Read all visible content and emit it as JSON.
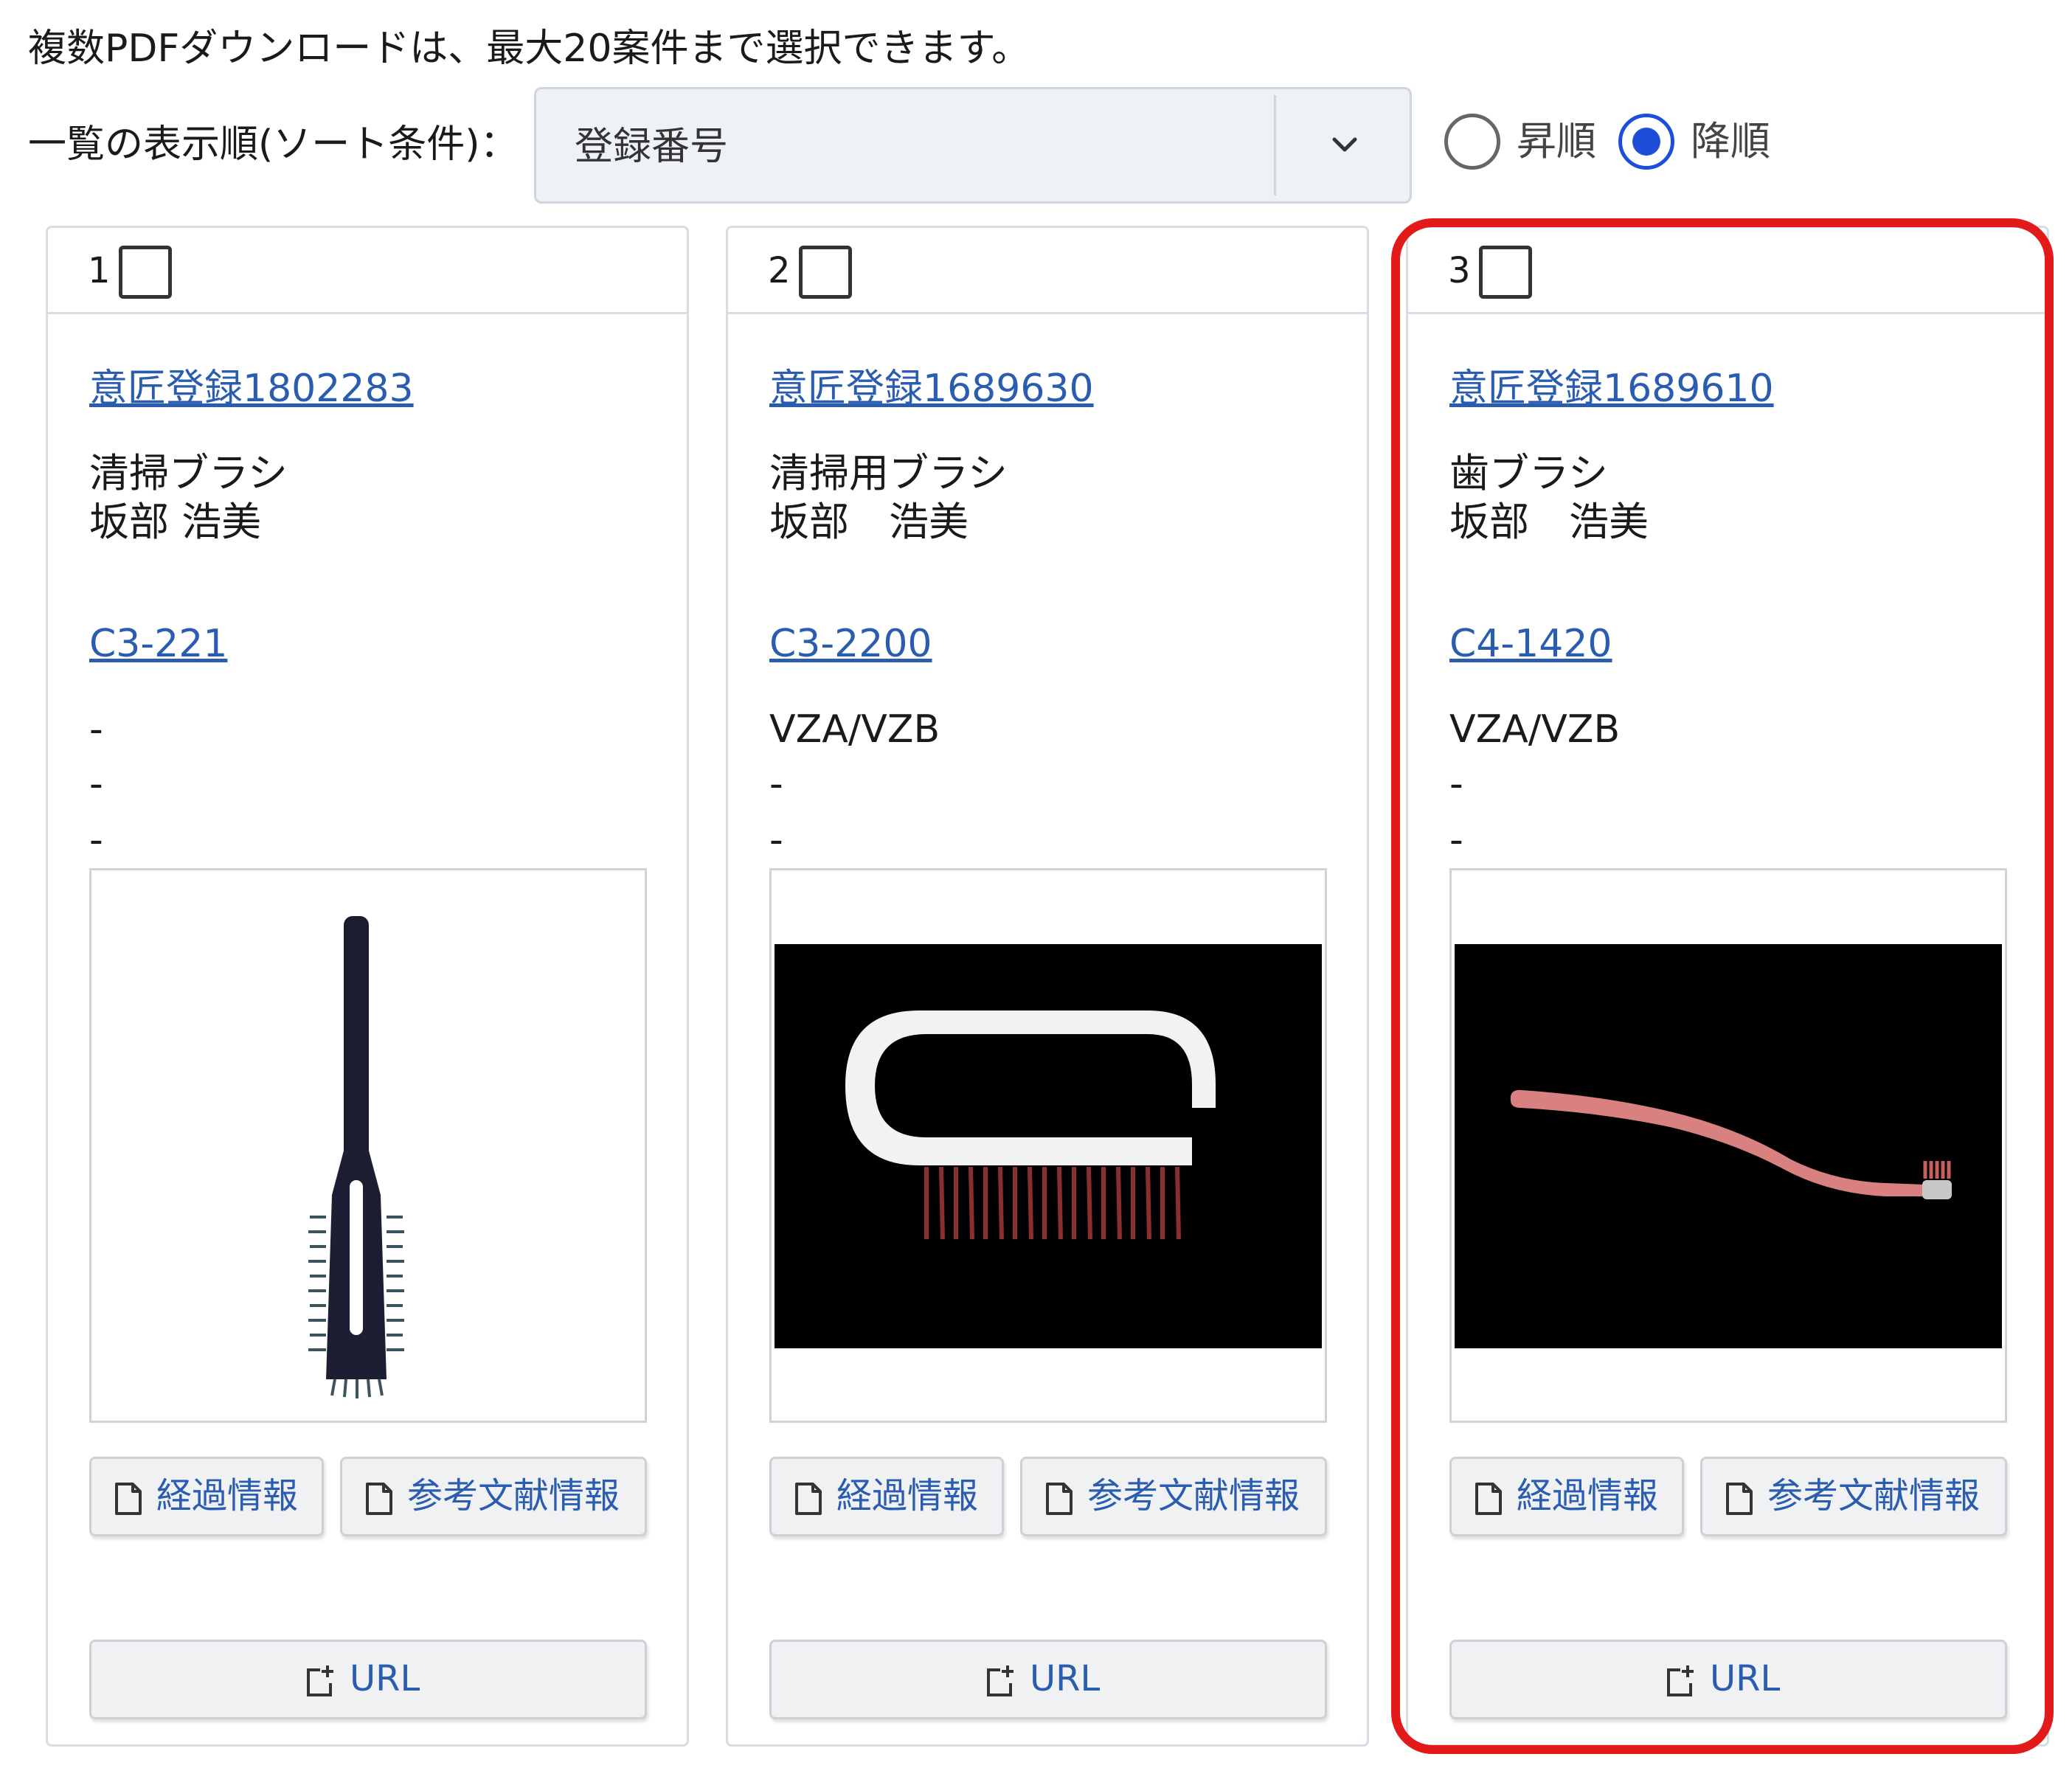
{
  "notice": "複数PDFダウンロードは、最大20案件まで選択できます。",
  "sort": {
    "label": "一覧の表示順(ソート条件)：",
    "selected": "登録番号",
    "order_options": [
      {
        "label": "昇順",
        "checked": false
      },
      {
        "label": "降順",
        "checked": true
      }
    ]
  },
  "cards": [
    {
      "number": "1",
      "checked": false,
      "registration": "意匠登録1802283",
      "name": "清掃ブラシ",
      "creator": "坂部 浩美",
      "class_code": "C3-221",
      "line_a": "-",
      "line_b": "-",
      "line_c": "-",
      "image": "vertical-cleaning-brush",
      "history_label": "経過情報",
      "reference_label": "参考文献情報",
      "url_label": "URL"
    },
    {
      "number": "2",
      "checked": false,
      "registration": "意匠登録1689630",
      "name": "清掃用ブラシ",
      "creator": "坂部　浩美",
      "class_code": "C3-2200",
      "line_a": "VZA/VZB",
      "line_b": "-",
      "line_c": "-",
      "image": "handle-scrub-brush",
      "history_label": "経過情報",
      "reference_label": "参考文献情報",
      "url_label": "URL"
    },
    {
      "number": "3",
      "checked": false,
      "registration": "意匠登録1689610",
      "name": "歯ブラシ",
      "creator": "坂部　浩美",
      "class_code": "C4-1420",
      "line_a": "VZA/VZB",
      "line_b": "-",
      "line_c": "-",
      "image": "toothbrush",
      "history_label": "経過情報",
      "reference_label": "参考文献情報",
      "url_label": "URL"
    }
  ],
  "colors": {
    "link": "#2a5db0",
    "radio_active": "#1d4ed8",
    "highlight": "#e21a1a"
  },
  "icons": {
    "select": "chevron-down-icon",
    "history": "document-icon",
    "reference": "document-icon",
    "url": "share-url-icon"
  }
}
